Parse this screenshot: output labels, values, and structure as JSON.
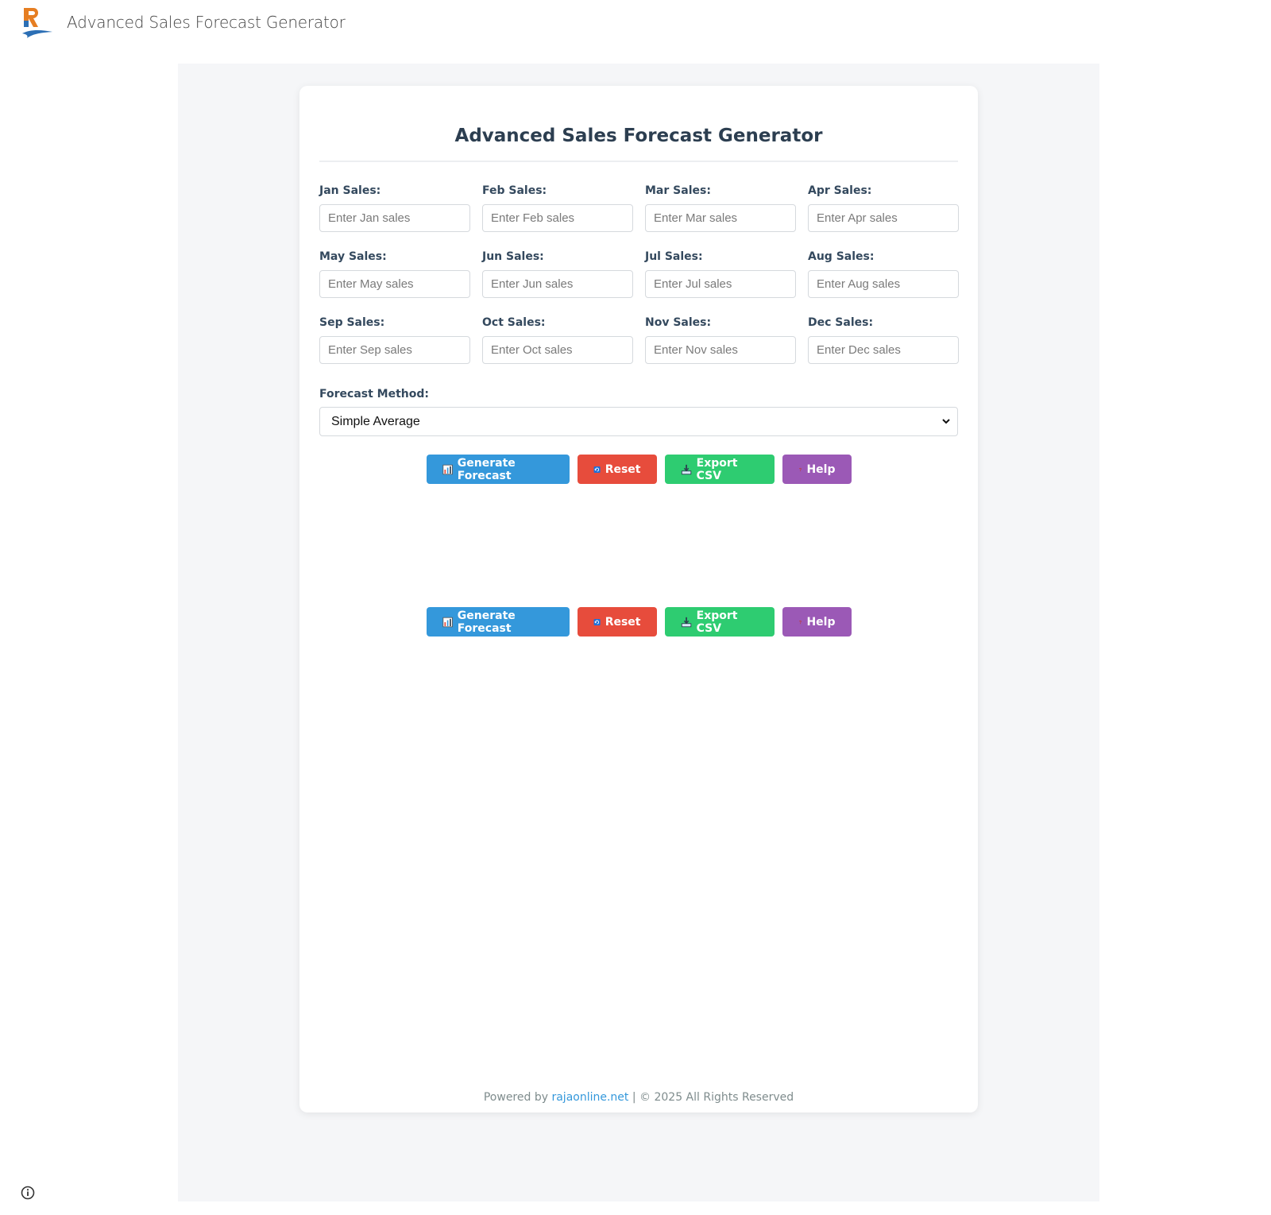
{
  "header": {
    "title": "Advanced Sales Forecast Generator",
    "logo_icon": "brand-logo-icon"
  },
  "card": {
    "title": "Advanced Sales Forecast Generator",
    "months": [
      {
        "label": "Jan Sales:",
        "placeholder": "Enter Jan sales",
        "value": ""
      },
      {
        "label": "Feb Sales:",
        "placeholder": "Enter Feb sales",
        "value": ""
      },
      {
        "label": "Mar Sales:",
        "placeholder": "Enter Mar sales",
        "value": ""
      },
      {
        "label": "Apr Sales:",
        "placeholder": "Enter Apr sales",
        "value": ""
      },
      {
        "label": "May Sales:",
        "placeholder": "Enter May sales",
        "value": ""
      },
      {
        "label": "Jun Sales:",
        "placeholder": "Enter Jun sales",
        "value": ""
      },
      {
        "label": "Jul Sales:",
        "placeholder": "Enter Jul sales",
        "value": ""
      },
      {
        "label": "Aug Sales:",
        "placeholder": "Enter Aug sales",
        "value": ""
      },
      {
        "label": "Sep Sales:",
        "placeholder": "Enter Sep sales",
        "value": ""
      },
      {
        "label": "Oct Sales:",
        "placeholder": "Enter Oct sales",
        "value": ""
      },
      {
        "label": "Nov Sales:",
        "placeholder": "Enter Nov sales",
        "value": ""
      },
      {
        "label": "Dec Sales:",
        "placeholder": "Enter Dec sales",
        "value": ""
      }
    ],
    "method": {
      "label": "Forecast Method:",
      "selected": "Simple Average"
    },
    "buttons": {
      "generate": "Generate Forecast",
      "reset": "Reset",
      "export": "Export CSV",
      "help": "Help"
    },
    "footer": {
      "prefix": "Powered by",
      "link": "rajaonline.net",
      "suffix": "| © 2025 All Rights Reserved"
    }
  },
  "colors": {
    "blue": "#3498db",
    "red": "#e74c3c",
    "green": "#2ecc71",
    "purple": "#9b59b6",
    "heading": "#2c3e50"
  },
  "icons": [
    "chart-icon",
    "refresh-icon",
    "download-icon",
    "question-icon",
    "info-icon"
  ]
}
